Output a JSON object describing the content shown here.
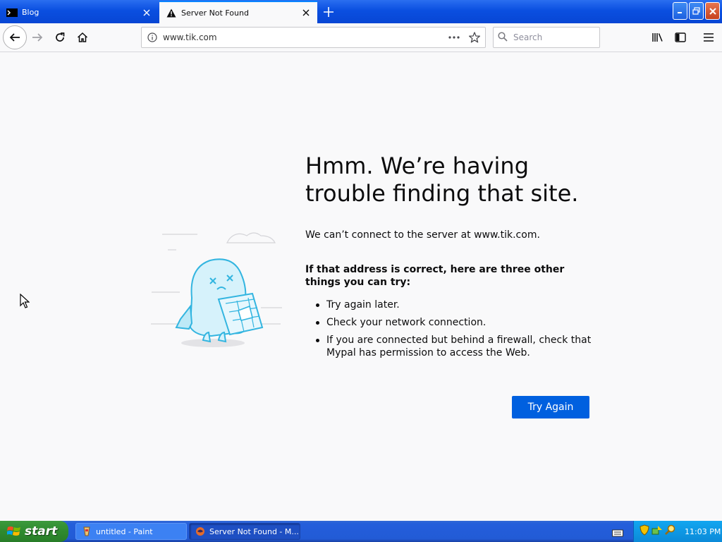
{
  "tabs": [
    {
      "label": "Blog"
    },
    {
      "label": "Server Not Found"
    }
  ],
  "navbar": {
    "url": "www.tik.com",
    "search_placeholder": "Search"
  },
  "error": {
    "title": "Hmm. We’re having trouble finding that site.",
    "description": "We can’t connect to the server at www.tik.com.",
    "suggestions_heading": "If that address is correct, here are three other things you can try:",
    "suggestions": [
      "Try again later.",
      "Check your network connection.",
      "If you are connected but behind a firewall, check that Mypal has permission to access the Web."
    ],
    "try_again_label": "Try Again"
  },
  "taskbar": {
    "start_label": "start",
    "tasks": [
      {
        "label": "untitled - Paint"
      },
      {
        "label": "Server Not Found - M..."
      }
    ],
    "clock": "11:03 PM"
  },
  "colors": {
    "accent": "#0060df",
    "titlebar_blue": "#0a4fe0",
    "start_green": "#2f8a2f"
  }
}
